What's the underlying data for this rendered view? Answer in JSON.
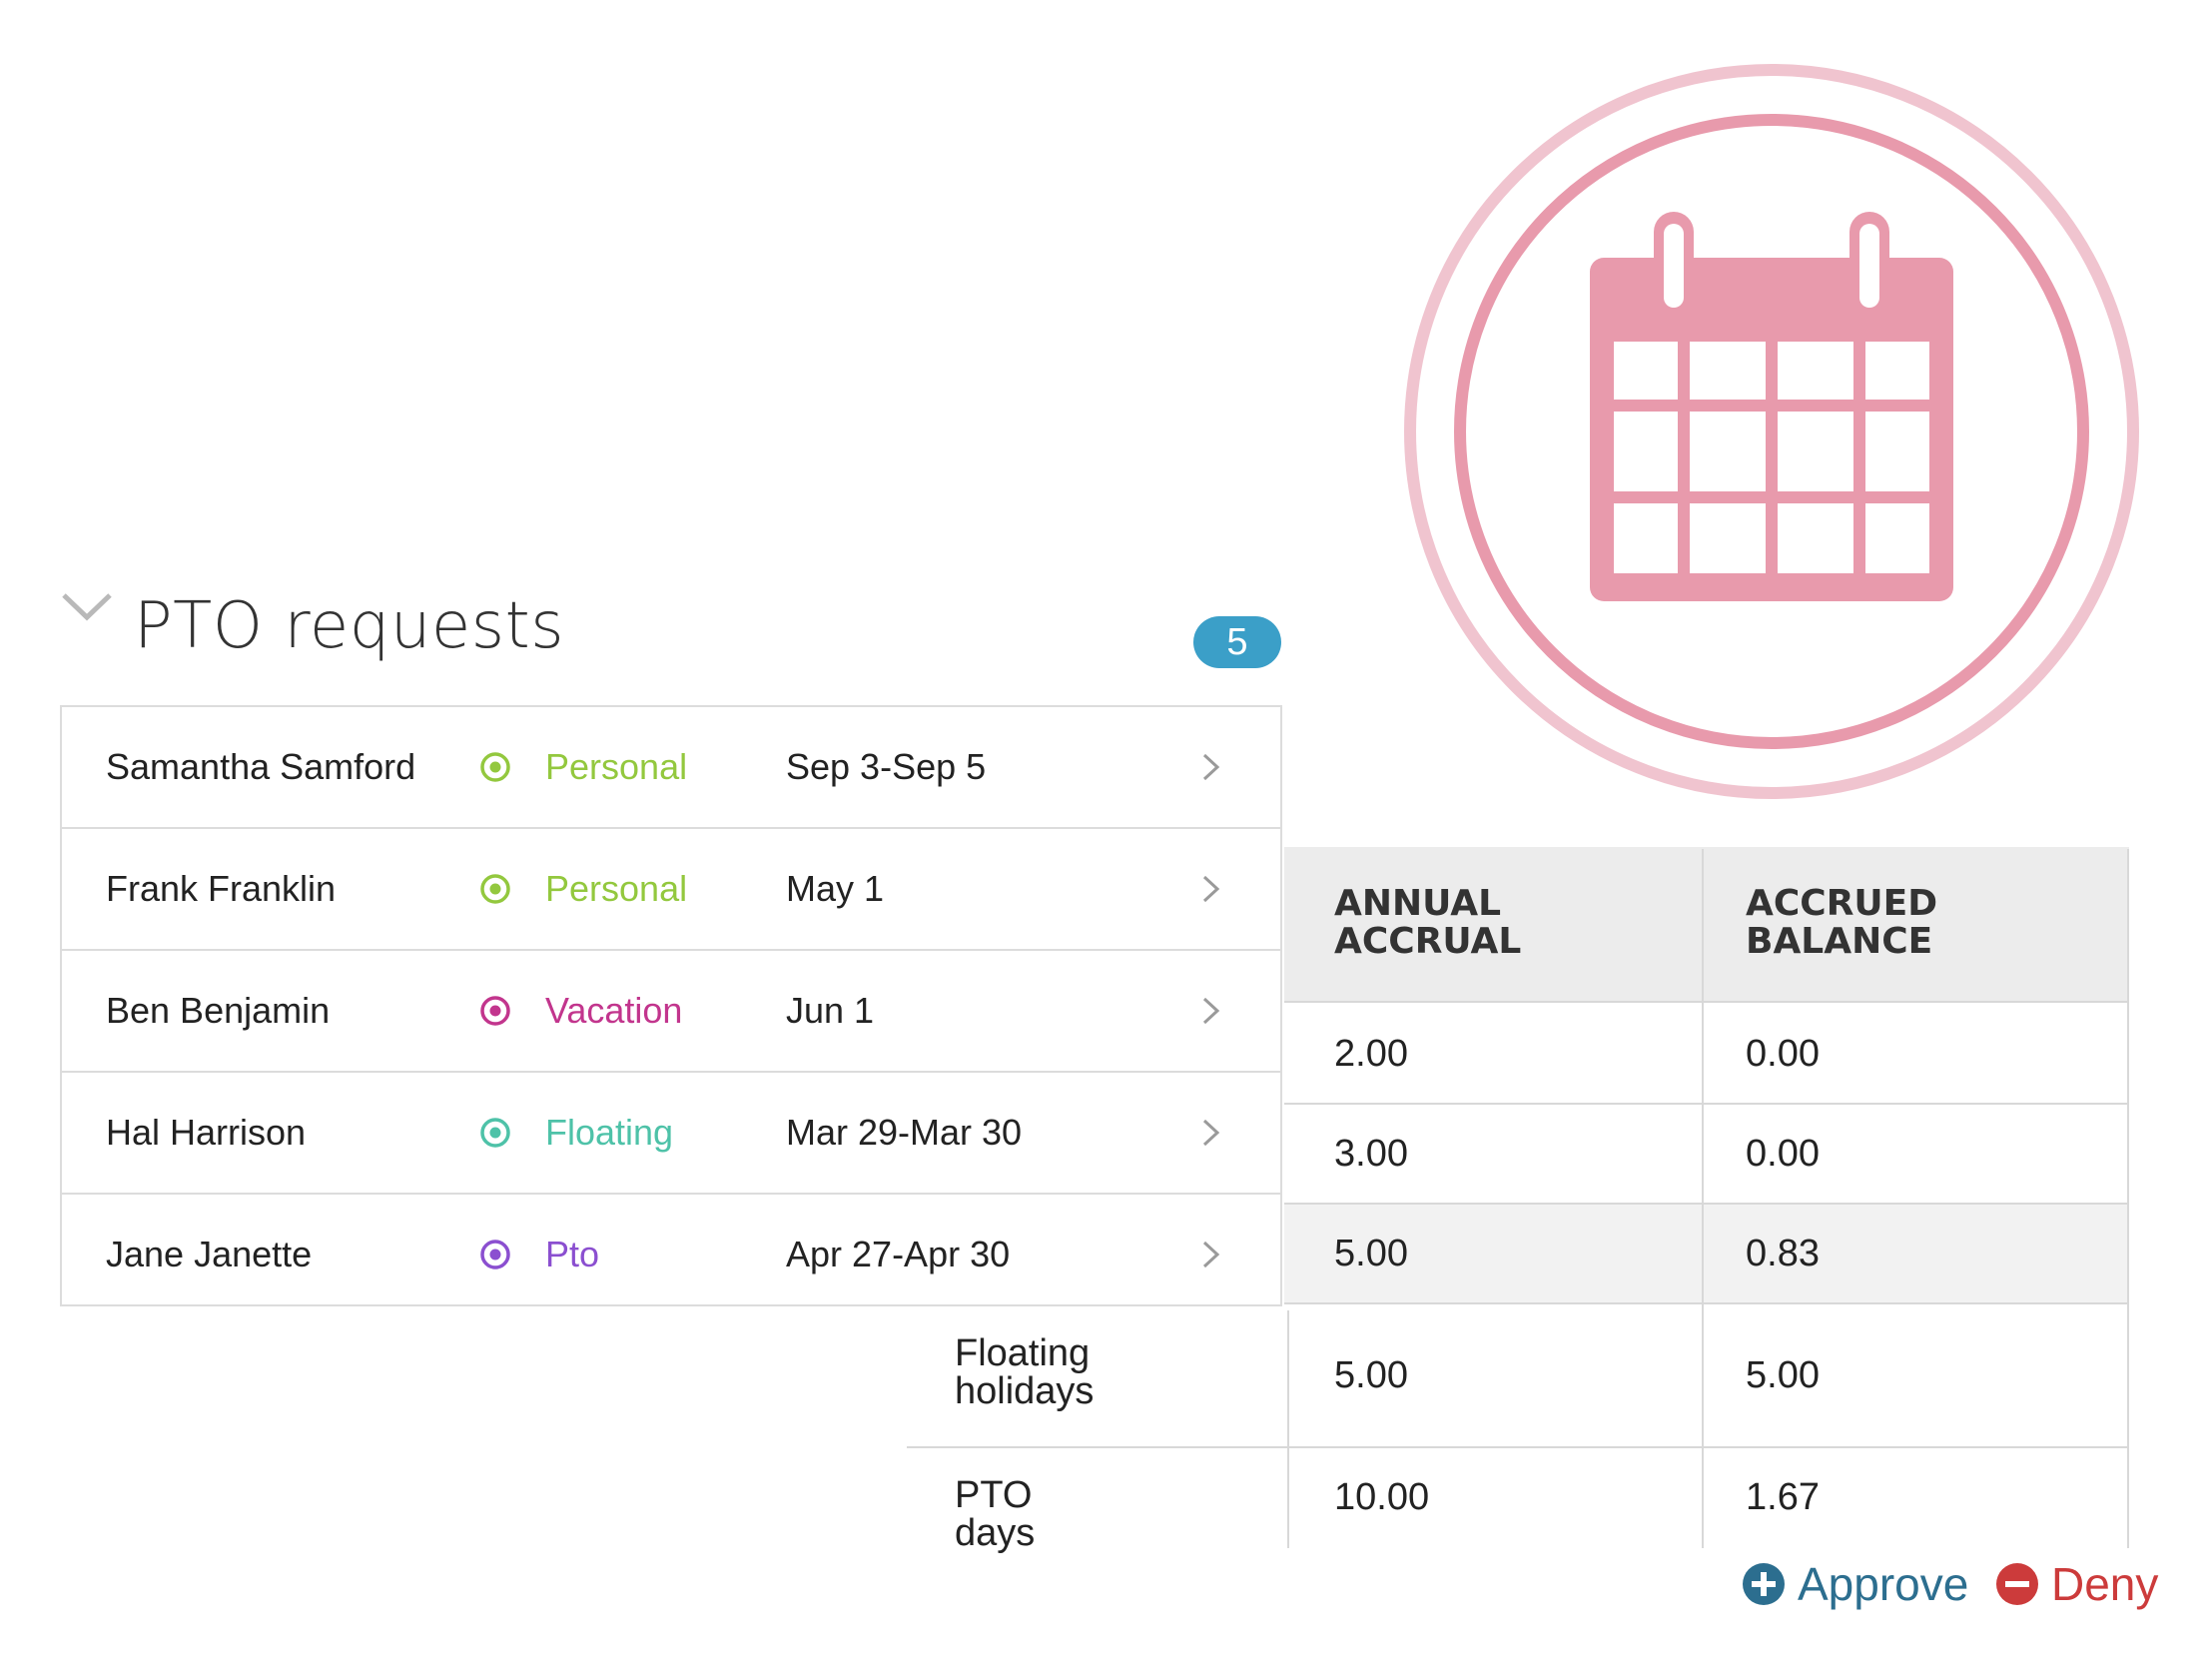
{
  "colors": {
    "emblem_pink": "#e89aac",
    "badge_blue": "#3b9fc8",
    "personal": "#93c83e",
    "vacation": "#c2358d",
    "floating": "#4ec2a8",
    "pto": "#8b4fd0",
    "approve": "#2c6e8f",
    "deny": "#cc3b3b"
  },
  "emblem": {
    "icon": "calendar-icon"
  },
  "section": {
    "title": "PTO requests",
    "count": "5",
    "toggle_icon": "chevron-down-icon"
  },
  "requests": [
    {
      "name": "Samantha Samford",
      "type": "Personal",
      "type_color": "#93c83e",
      "dates": "Sep 3-Sep 5"
    },
    {
      "name": "Frank Franklin",
      "type": "Personal",
      "type_color": "#93c83e",
      "dates": "May 1"
    },
    {
      "name": "Ben Benjamin",
      "type": "Vacation",
      "type_color": "#c2358d",
      "dates": "Jun 1"
    },
    {
      "name": "Hal Harrison",
      "type": "Floating",
      "type_color": "#4ec2a8",
      "dates": "Mar 29-Mar 30"
    },
    {
      "name": "Jane Janette",
      "type": "Pto",
      "type_color": "#8b4fd0",
      "dates": "Apr 27-Apr 30"
    }
  ],
  "accruals": {
    "headers": {
      "annual_line1": "ANNUAL",
      "annual_line2": "ACCRUAL",
      "accrued_line1": "ACCRUED",
      "accrued_line2": "BALANCE"
    },
    "rows": [
      {
        "label_line1": "",
        "label_line2": "",
        "annual": "2.00",
        "accrued": "0.00"
      },
      {
        "label_line1": "",
        "label_line2": "",
        "annual": "3.00",
        "accrued": "0.00"
      },
      {
        "label_line1": "",
        "label_line2": "",
        "annual": "5.00",
        "accrued": "0.83"
      },
      {
        "label_line1": "Floating",
        "label_line2": "holidays",
        "annual": "5.00",
        "accrued": "5.00"
      },
      {
        "label_line1": "PTO days",
        "label_line2": "",
        "annual": "10.00",
        "accrued": "1.67"
      }
    ]
  },
  "actions": {
    "approve": "Approve",
    "deny": "Deny"
  }
}
